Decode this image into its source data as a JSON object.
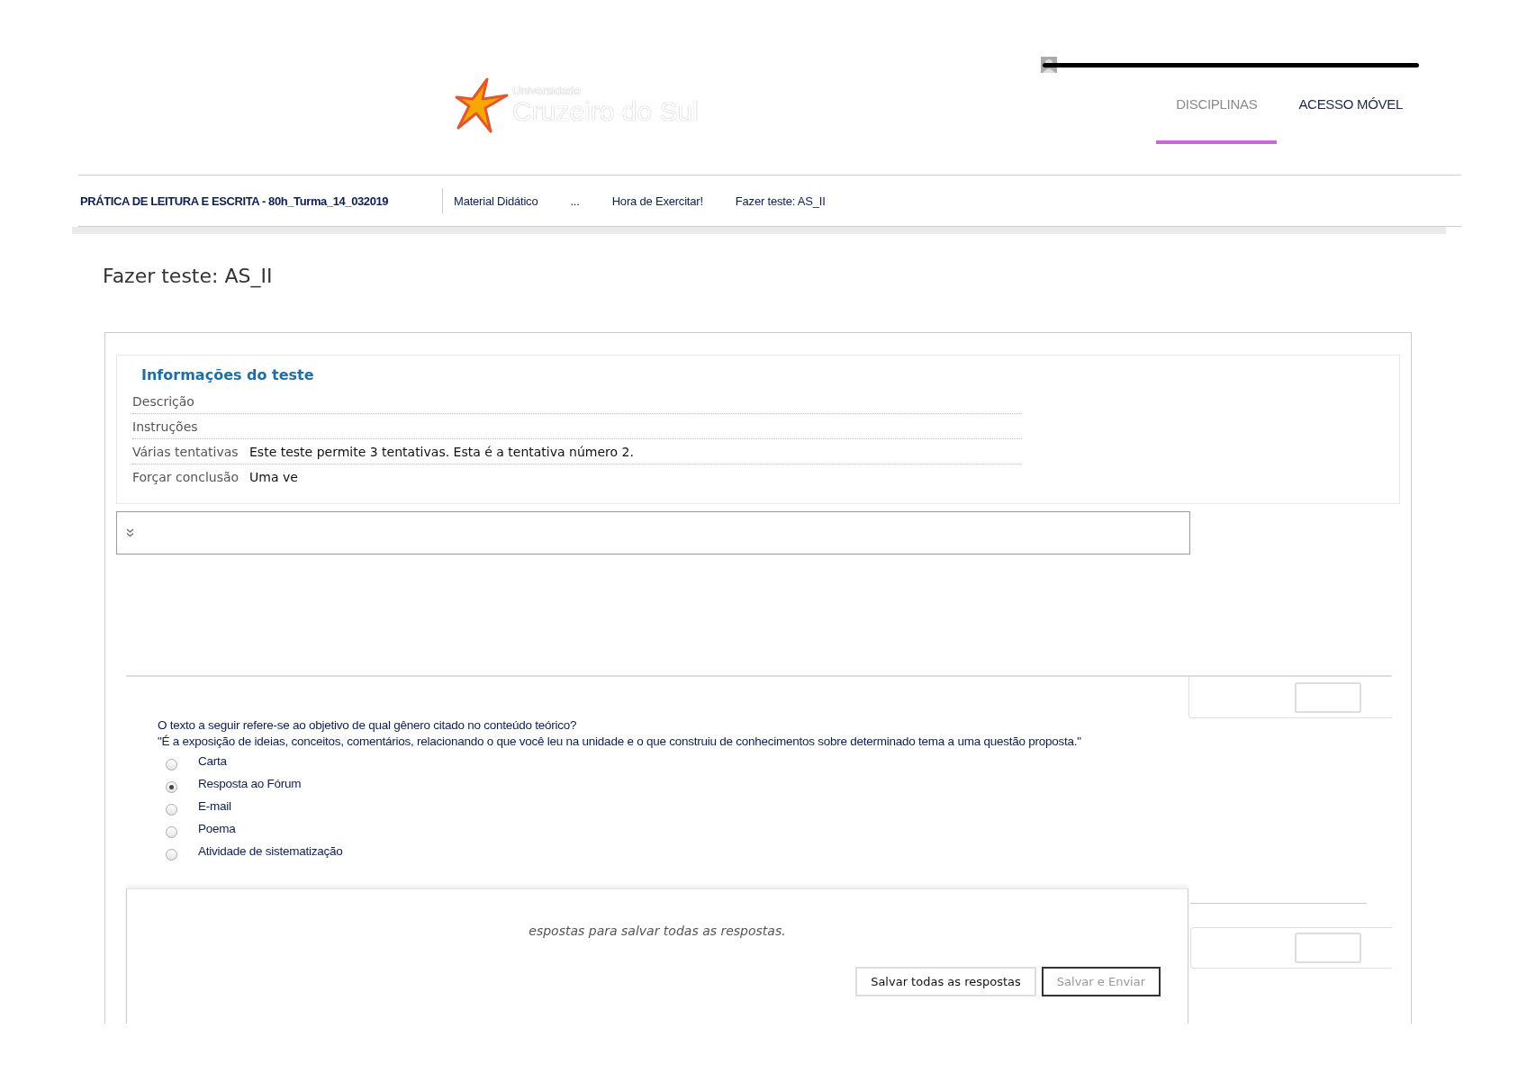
{
  "header": {
    "logo": {
      "line_1": "Universidade",
      "line_2": "Cruzeiro do Sul"
    }
  },
  "nav_tabs": [
    {
      "label": "DISCIPLINAS",
      "selected": true
    },
    {
      "label": "ACESSO MÓVEL",
      "selected": false
    }
  ],
  "breadcrumb": {
    "course": "PRÁTICA DE LEITURA E ESCRITA - 80h_Turma_14_032019",
    "items": [
      "Material Didático",
      "...",
      "Hora de Exercitar!",
      "Fazer teste: AS_II"
    ]
  },
  "page_title": "Fazer teste: AS_II",
  "test_info": {
    "heading": "Informações do teste",
    "rows": [
      {
        "label": "Descrição"
      },
      {
        "label": "Instruções"
      },
      {
        "label": "Várias tentativas",
        "value": "Este teste permite 3 tentativas. Esta é a tentativa número 2."
      },
      {
        "label": "Forçar conclusão",
        "value": "Uma ve"
      }
    ]
  },
  "question": {
    "prompt": "O texto a seguir refere-se ao objetivo de qual gênero citado no conteúdo teórico?",
    "quote": "\"É a exposição de ideias, conceitos, comentários, relacionando o que você leu na unidade e o que construiu de conhecimentos sobre determinado tema a uma questão proposta.\"",
    "options": [
      {
        "label": "Carta",
        "selected": false
      },
      {
        "label": "Resposta ao Fórum",
        "selected": true
      },
      {
        "label": "E-mail",
        "selected": false
      },
      {
        "label": "Poema",
        "selected": false
      },
      {
        "label": "Atividade de sistematização",
        "selected": false
      }
    ]
  },
  "save_bar": {
    "message": "espostas para salvar todas as respostas.",
    "buttons": [
      {
        "label": "Salvar todas as respostas",
        "disabled": false
      },
      {
        "label": "Salvar e Enviar",
        "disabled": true
      }
    ]
  }
}
